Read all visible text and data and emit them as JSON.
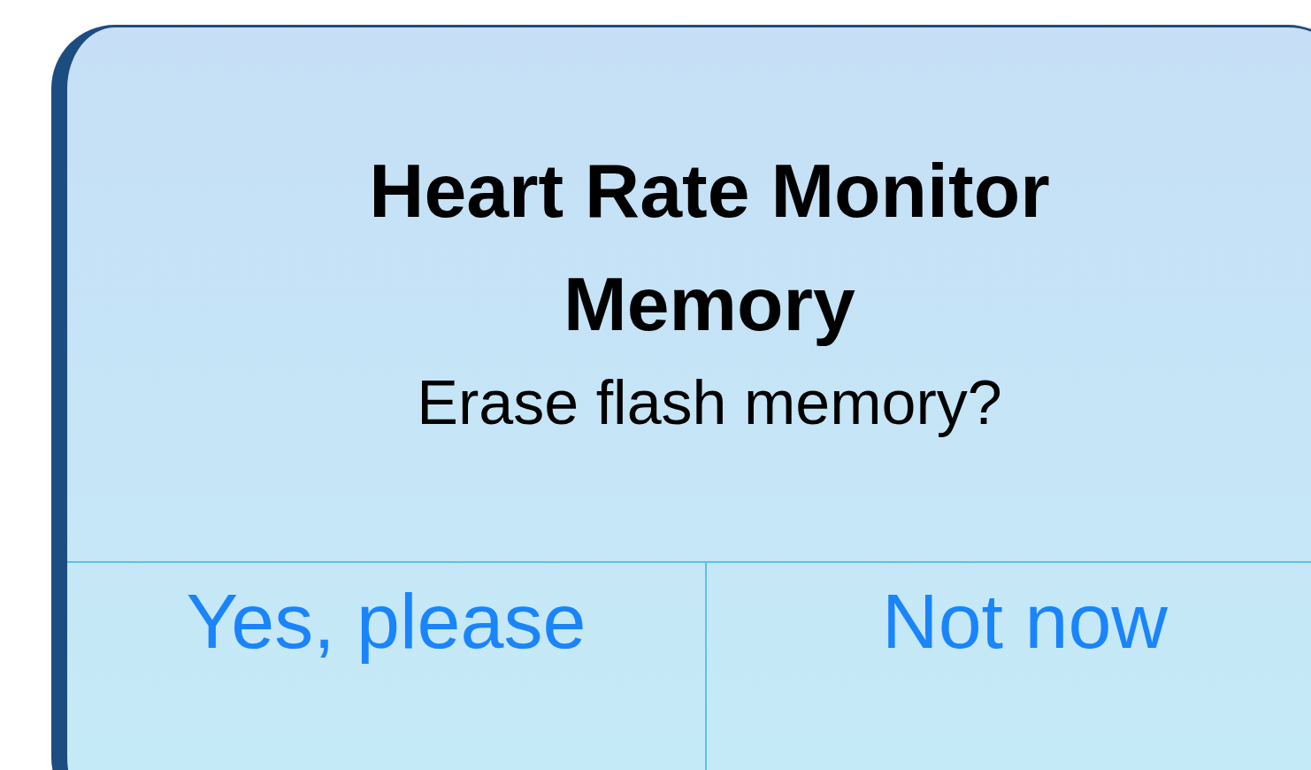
{
  "alert": {
    "title": "Heart Rate Monitor Memory",
    "message": "Erase flash memory?",
    "buttons": [
      {
        "label": "Yes, please"
      },
      {
        "label": "Not now"
      }
    ]
  }
}
